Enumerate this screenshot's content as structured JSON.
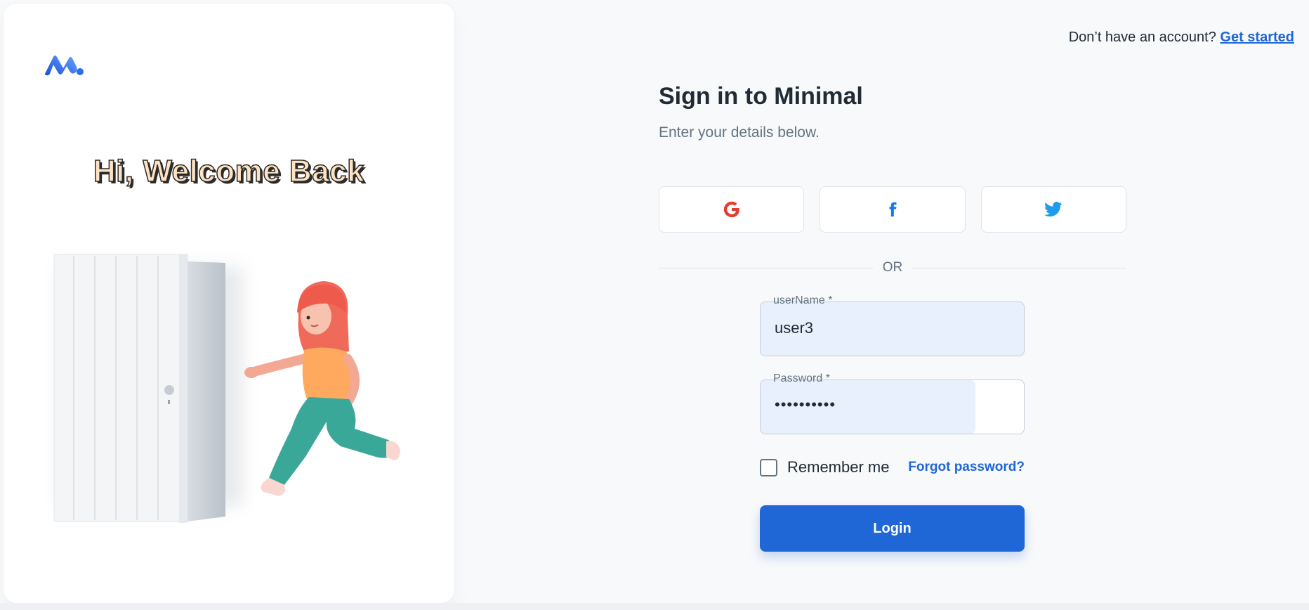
{
  "header": {
    "prompt": "Don’t have an account?",
    "link": "Get started"
  },
  "left": {
    "welcome": "Hi, Welcome Back"
  },
  "form": {
    "title": "Sign in to Minimal",
    "subtitle": "Enter your details below.",
    "divider": "OR",
    "social": [
      "google-icon",
      "facebook-icon",
      "twitter-icon"
    ],
    "username": {
      "label": "userName *",
      "value": "user3"
    },
    "password": {
      "label": "Password *",
      "value": "••••••••••"
    },
    "remember_label": "Remember me",
    "remember_checked": false,
    "forgot_label": "Forgot password?",
    "login_label": "Login"
  },
  "colors": {
    "primary": "#1f66d6",
    "google": "#df3e30",
    "facebook": "#1877f2",
    "twitter": "#1c9cea",
    "autofill": "#e8f0fe"
  }
}
